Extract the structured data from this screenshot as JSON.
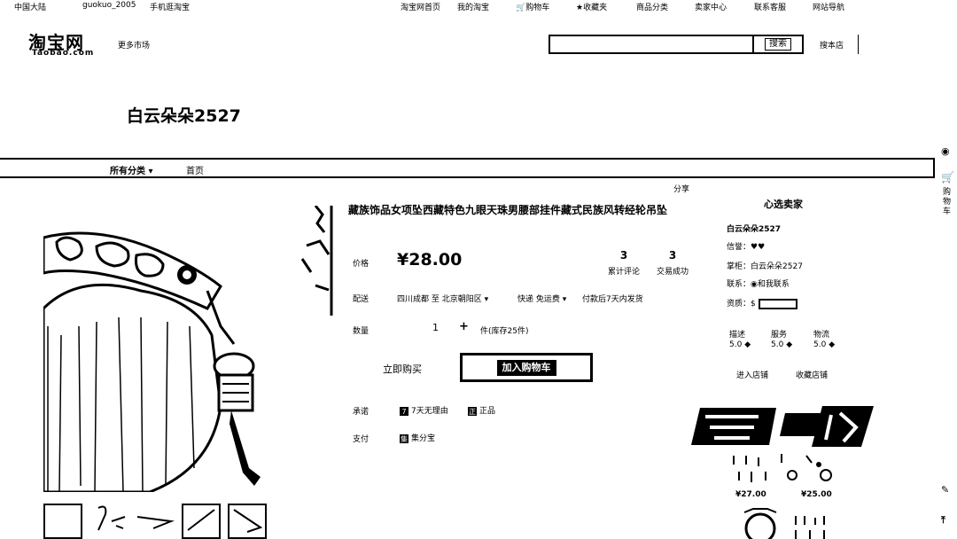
{
  "topbar": {
    "region": "中国大陆",
    "username": "guokuo_2005",
    "mobile": "手机逛淘宝",
    "home": "淘宝网首页",
    "my_taobao": "我的淘宝",
    "cart": "购物车",
    "favorites": "收藏夹",
    "categories": "商品分类",
    "seller_center": "卖家中心",
    "service": "联系客服",
    "sitemap": "网站导航"
  },
  "header": {
    "logo": "淘宝网",
    "logo_sub": "Taobao.com",
    "market": "更多市场",
    "search_button": "搜索",
    "this_shop": "搜本店"
  },
  "store": {
    "name": "白云朵朵2527"
  },
  "nav": {
    "items": [
      "所有分类",
      "首页"
    ]
  },
  "product": {
    "share": "分享",
    "title": "藏族饰品女项坠西藏特色九眼天珠男腰部挂件藏式民族风转经轮吊坠",
    "price_label": "价格",
    "price": "¥28.00",
    "reviews_count": "3",
    "reviews_label": "累计评论",
    "sales_count": "3",
    "sales_label": "交易成功",
    "delivery_label": "配送",
    "delivery_text": "四川成都 至 北京朝阳区",
    "shipping": "快递 免运费",
    "pay_note": "付款后7天内发货",
    "qty_label": "数量",
    "qty_value": "1",
    "qty_plus": "+",
    "stock": "件(库存25件)",
    "buy_now": "立即购买",
    "add_cart": "加入购物车",
    "promise_label": "承诺",
    "promise_1": "7天无理由",
    "promise_2": "正品",
    "payment_label": "支付",
    "payment_1": "集分宝"
  },
  "seller": {
    "title": "心选卖家",
    "name": "白云朵朵2527",
    "credit_label": "信誉：",
    "shop_label": "掌柜：",
    "shop_value": "白云朵朵2527",
    "contact_label": "联系：",
    "contact_value": "和我联系",
    "qual_label": "资质：",
    "scores": [
      {
        "label": "描述",
        "value": "5.0"
      },
      {
        "label": "服务",
        "value": "5.0"
      },
      {
        "label": "物流",
        "value": "5.0"
      }
    ],
    "enter_shop": "进入店铺",
    "fav_shop": "收藏店铺",
    "rec_prices": [
      "¥27.00",
      "¥25.00"
    ]
  },
  "sidebar": {
    "cart_label": "购物车"
  }
}
